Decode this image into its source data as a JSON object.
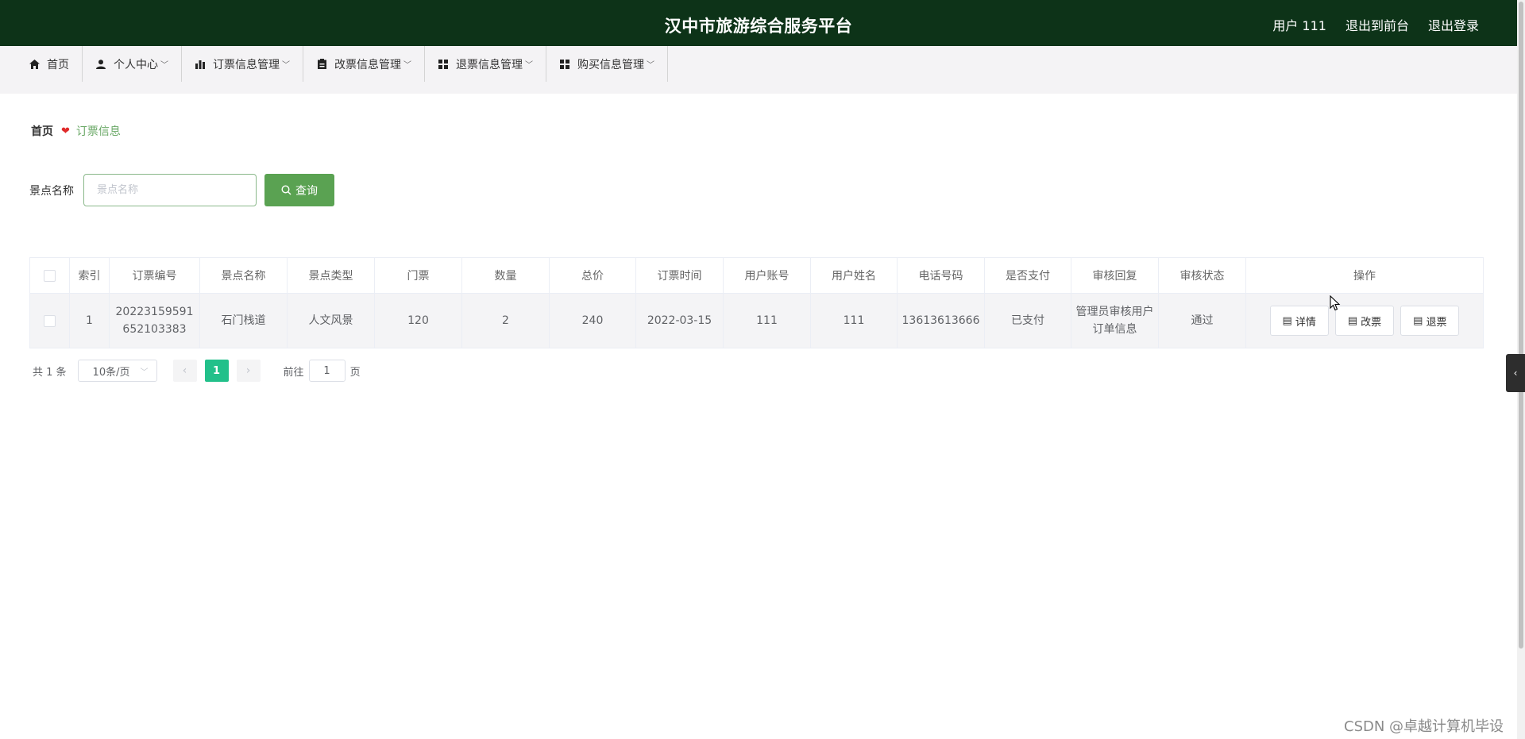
{
  "header": {
    "title": "汉中市旅游综合服务平台",
    "user_label": "用户 111",
    "front_label": "退出到前台",
    "logout_label": "退出登录",
    "bg_color": "#0d3318"
  },
  "nav": {
    "items": [
      {
        "label": "首页",
        "icon": "home-icon",
        "has_menu": false
      },
      {
        "label": "个人中心",
        "icon": "user-icon",
        "has_menu": true
      },
      {
        "label": "订票信息管理",
        "icon": "bar-chart-icon",
        "has_menu": true
      },
      {
        "label": "改票信息管理",
        "icon": "clipboard-icon",
        "has_menu": true
      },
      {
        "label": "退票信息管理",
        "icon": "grid-icon",
        "has_menu": true
      },
      {
        "label": "购买信息管理",
        "icon": "grid-icon",
        "has_menu": true
      }
    ]
  },
  "breadcrumb": {
    "home": "首页",
    "current": "订票信息"
  },
  "search": {
    "label": "景点名称",
    "placeholder": "景点名称",
    "button_label": "查询",
    "button_color": "#5aa252"
  },
  "table": {
    "headers": [
      "索引",
      "订票编号",
      "景点名称",
      "景点类型",
      "门票",
      "数量",
      "总价",
      "订票时间",
      "用户账号",
      "用户姓名",
      "电话号码",
      "是否支付",
      "审核回复",
      "审核状态",
      "操作"
    ],
    "rows": [
      {
        "index": "1",
        "order_no": "20223159591652103383",
        "spot_name": "石门栈道",
        "spot_type": "人文风景",
        "ticket": "120",
        "quantity": "2",
        "total": "240",
        "order_time": "2022-03-15",
        "account": "111",
        "name": "111",
        "phone": "13613613666",
        "paid": "已支付",
        "review_reply": "管理员审核用户订单信息",
        "review_status": "通过"
      }
    ],
    "actions": {
      "detail": "详情",
      "change": "改票",
      "refund": "退票"
    }
  },
  "pagination": {
    "total_text": "共 1 条",
    "page_size": "10条/页",
    "current_page": "1",
    "goto_prefix": "前往",
    "goto_value": "1",
    "goto_suffix": "页",
    "active_color": "#22c08a"
  },
  "watermark": "CSDN @卓越计算机毕设"
}
